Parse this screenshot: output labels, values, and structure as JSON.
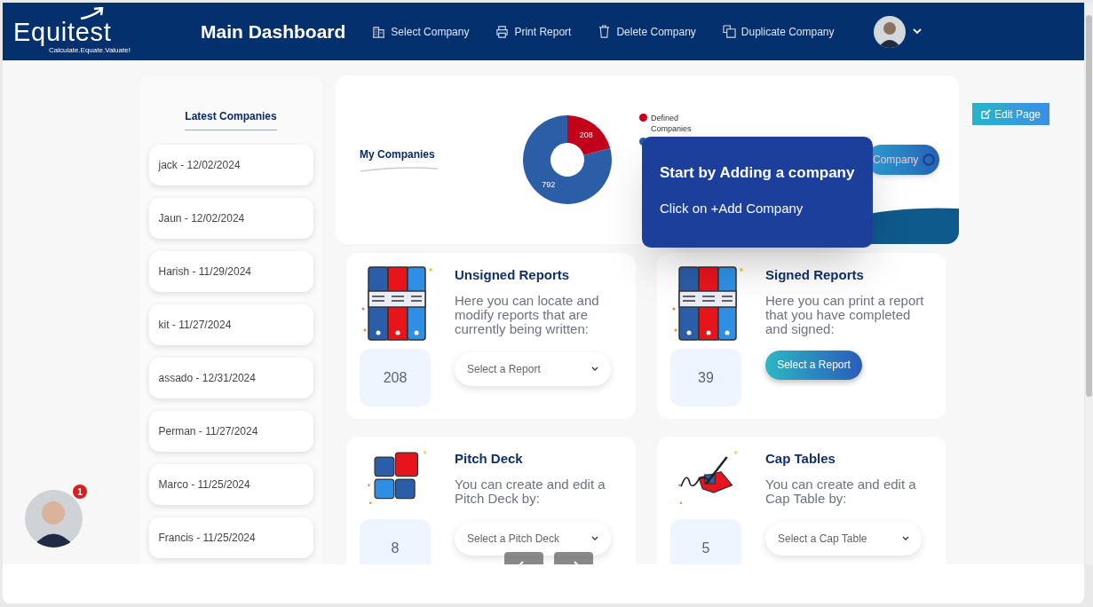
{
  "header": {
    "logo": "Equitest",
    "tagline": "Calculate.Equate.Valuate!",
    "title": "Main Dashboard",
    "nav": [
      {
        "label": "Select Company"
      },
      {
        "label": "Print Report"
      },
      {
        "label": "Delete Company"
      },
      {
        "label": "Duplicate Company"
      }
    ]
  },
  "sidebar": {
    "title": "Latest Companies",
    "items": [
      "jack - 12/02/2024",
      "Jaun - 12/02/2024",
      "Harish - 11/29/2024",
      "kit - 11/27/2024",
      "assado - 12/31/2024",
      "Perman - 11/27/2024",
      "Marco - 11/25/2024",
      "Francis - 11/25/2024"
    ]
  },
  "companies_card": {
    "title": "My Companies",
    "chart_data": {
      "type": "donut",
      "categories": [
        "Defined Companies",
        null
      ],
      "values": [
        208,
        792
      ],
      "colors": [
        "#c3001a",
        "#2b5ea7"
      ],
      "data_labels": true
    },
    "add_button": "Company"
  },
  "tooltip": {
    "title": "Start by Adding a company",
    "text": "Click on +Add Company"
  },
  "edit_button": "Edit Page",
  "cards": [
    {
      "title": "Unsigned Reports",
      "text": "Here you can locate and modify reports that are currently being written:",
      "count": "208",
      "kind": "dropdown",
      "control": "Select a Report"
    },
    {
      "title": "Signed Reports",
      "text": "Here you can print a report that you have completed and signed:",
      "count": "39",
      "kind": "button",
      "control": "Select a Report"
    },
    {
      "title": "Pitch Deck",
      "text": "You can create and edit a Pitch Deck by:",
      "count": "8",
      "kind": "dropdown",
      "control": "Select a Pitch Deck"
    },
    {
      "title": "Cap Tables",
      "text": "You can create and edit a Cap Table by:",
      "count": "5",
      "kind": "dropdown",
      "control": "Select a Cap Table"
    }
  ],
  "chat": {
    "badge": "1"
  }
}
